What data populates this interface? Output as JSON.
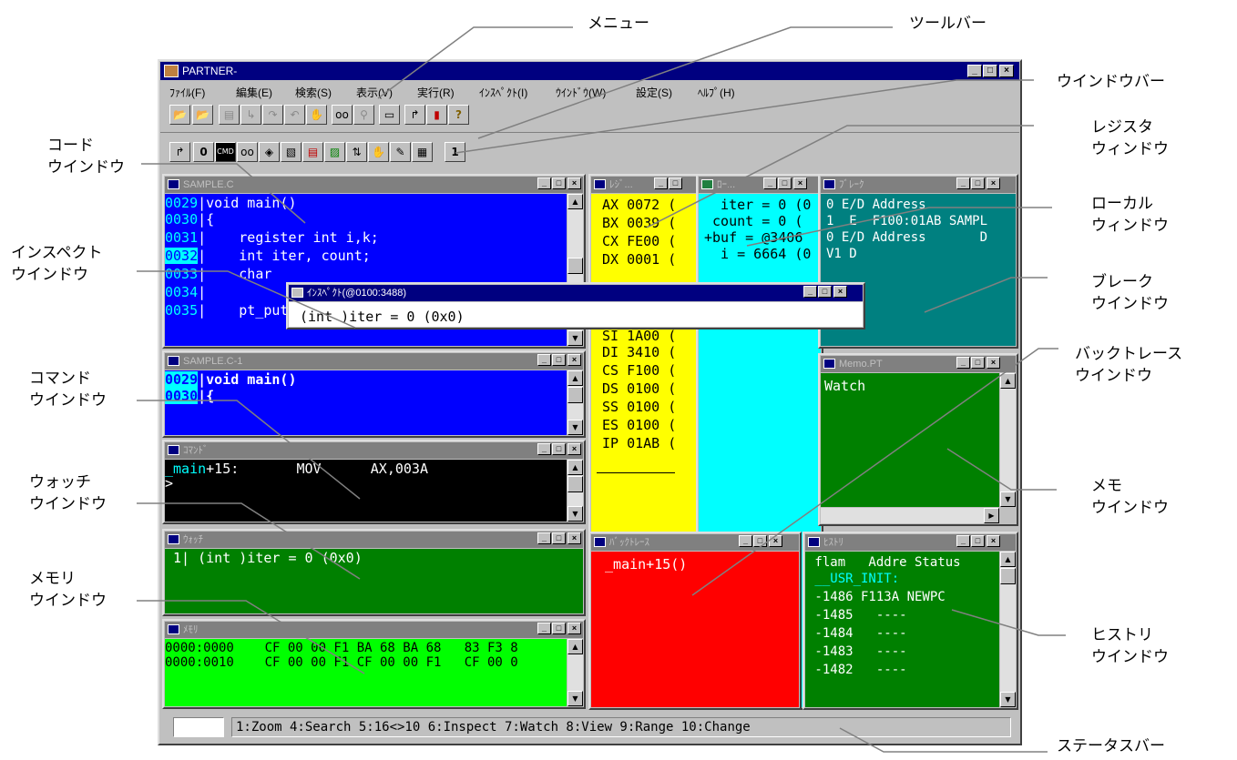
{
  "app": {
    "title": "PARTNER-",
    "menu": [
      "ﾌｧｲﾙ(F)",
      "編集(E)",
      "検索(S)",
      "表示(V)",
      "実行(R)",
      "ｲﾝｽﾍﾟｸﾄ(I)",
      "ｳｲﾝﾄﾞｳ(W)",
      "設定(S)",
      "ﾍﾙﾌﾟ(H)"
    ],
    "window_controls": [
      "_",
      "□",
      "×"
    ]
  },
  "toolbar": {
    "row1": [
      "open-icon",
      "open-run-icon",
      "step-icon",
      "step-into-icon",
      "step-over-icon",
      "return-icon",
      "stop-hand-icon",
      "watch-glasses-icon",
      "inspect-magnifier-icon",
      "help-window-icon",
      "go-icon",
      "exit-door-icon",
      "help-question-icon"
    ],
    "row2": [
      "code-window-icon",
      "register-window-icon",
      "command-window-icon",
      "watch-window-icon",
      "memory-window-icon",
      "break-window-icon",
      "local-window-icon",
      "image-window-icon",
      "trace-window-icon",
      "hand-window-icon",
      "memo-window-icon",
      "history-window-icon",
      "window-bar-icon"
    ],
    "window_bar_label": "1"
  },
  "code_window": {
    "title": "SAMPLE.C",
    "line_numbers": [
      "0029",
      "0030",
      "0031",
      "0032",
      "0033",
      "0034",
      "0035"
    ],
    "lines": [
      "void main()",
      "{",
      "    register int i,k;",
      "    int iter, count;",
      "    char",
      "",
      "    pt_puts(title);"
    ]
  },
  "code_window_2": {
    "title": "SAMPLE.C-1",
    "line_numbers": [
      "0029",
      "0030"
    ],
    "lines": [
      "void main()",
      "{"
    ]
  },
  "inspect_window": {
    "title": "ｲﾝｽﾍﾟｸﾄ(@0100:3488)",
    "content": "(int )iter = 0 (0x0)"
  },
  "register_window": {
    "title": "ﾚｼﾞ...",
    "registers": [
      "AX 0072 (",
      "BX 0039 (",
      "CX FE00 (",
      "DX 0001 (",
      "SI 1A00 (",
      "DI 3410 (",
      "CS F100 (",
      "DS 0100 (",
      "SS 0100 (",
      "ES 0100 (",
      "IP 01AB ("
    ]
  },
  "local_window": {
    "title": "ﾛｰ...",
    "lines": [
      "  iter = 0 (0",
      " count = 0 (",
      "+buf = @3406",
      "  i = 6664 (0"
    ]
  },
  "break_window": {
    "title": "ﾌﾞﾚｰｸ",
    "lines": [
      "0 E/D Address",
      "1  E  F100:01AB SAMPL",
      "0 E/D Address       D",
      "V1 D"
    ]
  },
  "command_window": {
    "title": "ｺﾏﾝﾄﾞ",
    "line1_symbol": "_main",
    "line1_rest": "+15:       MOV      AX,003A",
    "line2": ">"
  },
  "memo_window": {
    "title": "Memo.PT",
    "content": "Watch"
  },
  "watch_window": {
    "title": "ｳｫｯﾁ",
    "content": " 1| (int )iter = 0 (0x0)"
  },
  "backtrace_window": {
    "title": "ﾊﾞｯｸﾄﾚｰｽ",
    "content": " _main+15()"
  },
  "history_window": {
    "title": "ﾋｽﾄﾘ",
    "header": " flam   Addre Status",
    "label": " __USR_INIT:",
    "rows": [
      " -1486 F113A NEWPC",
      " -1485   ----",
      " -1484   ----",
      " -1483   ----",
      " -1482   ----"
    ]
  },
  "memory_window": {
    "title": "ﾒﾓﾘ",
    "rows": [
      "0000:0000    CF 00 00 F1 BA 68 BA 68   83 F3 8",
      "0000:0010    CF 00 00 F1 CF 00 00 F1   CF 00 0"
    ]
  },
  "status_bar": {
    "text": "1:Zoom 4:Search 5:16<>10 6:Inspect 7:Watch 8:View 9:Range 10:Change"
  },
  "annotations": {
    "menu": "メニュー",
    "toolbar": "ツールバー",
    "window_bar": "ウインドウバー",
    "register": "レジスタ\nウィンドウ",
    "code": "コード\nウインドウ",
    "local": "ローカル\nウィンドウ",
    "inspect": "インスペクト\nウインドウ",
    "break": "ブレーク\nウインドウ",
    "command": "コマンド\nウインドウ",
    "backtrace": "バックトレース\nウインドウ",
    "watch": "ウォッチ\nウインドウ",
    "memo": "メモ\nウインドウ",
    "memory": "メモリ\nウインドウ",
    "history": "ヒストリ\nウインドウ",
    "status": "ステータスバー"
  }
}
